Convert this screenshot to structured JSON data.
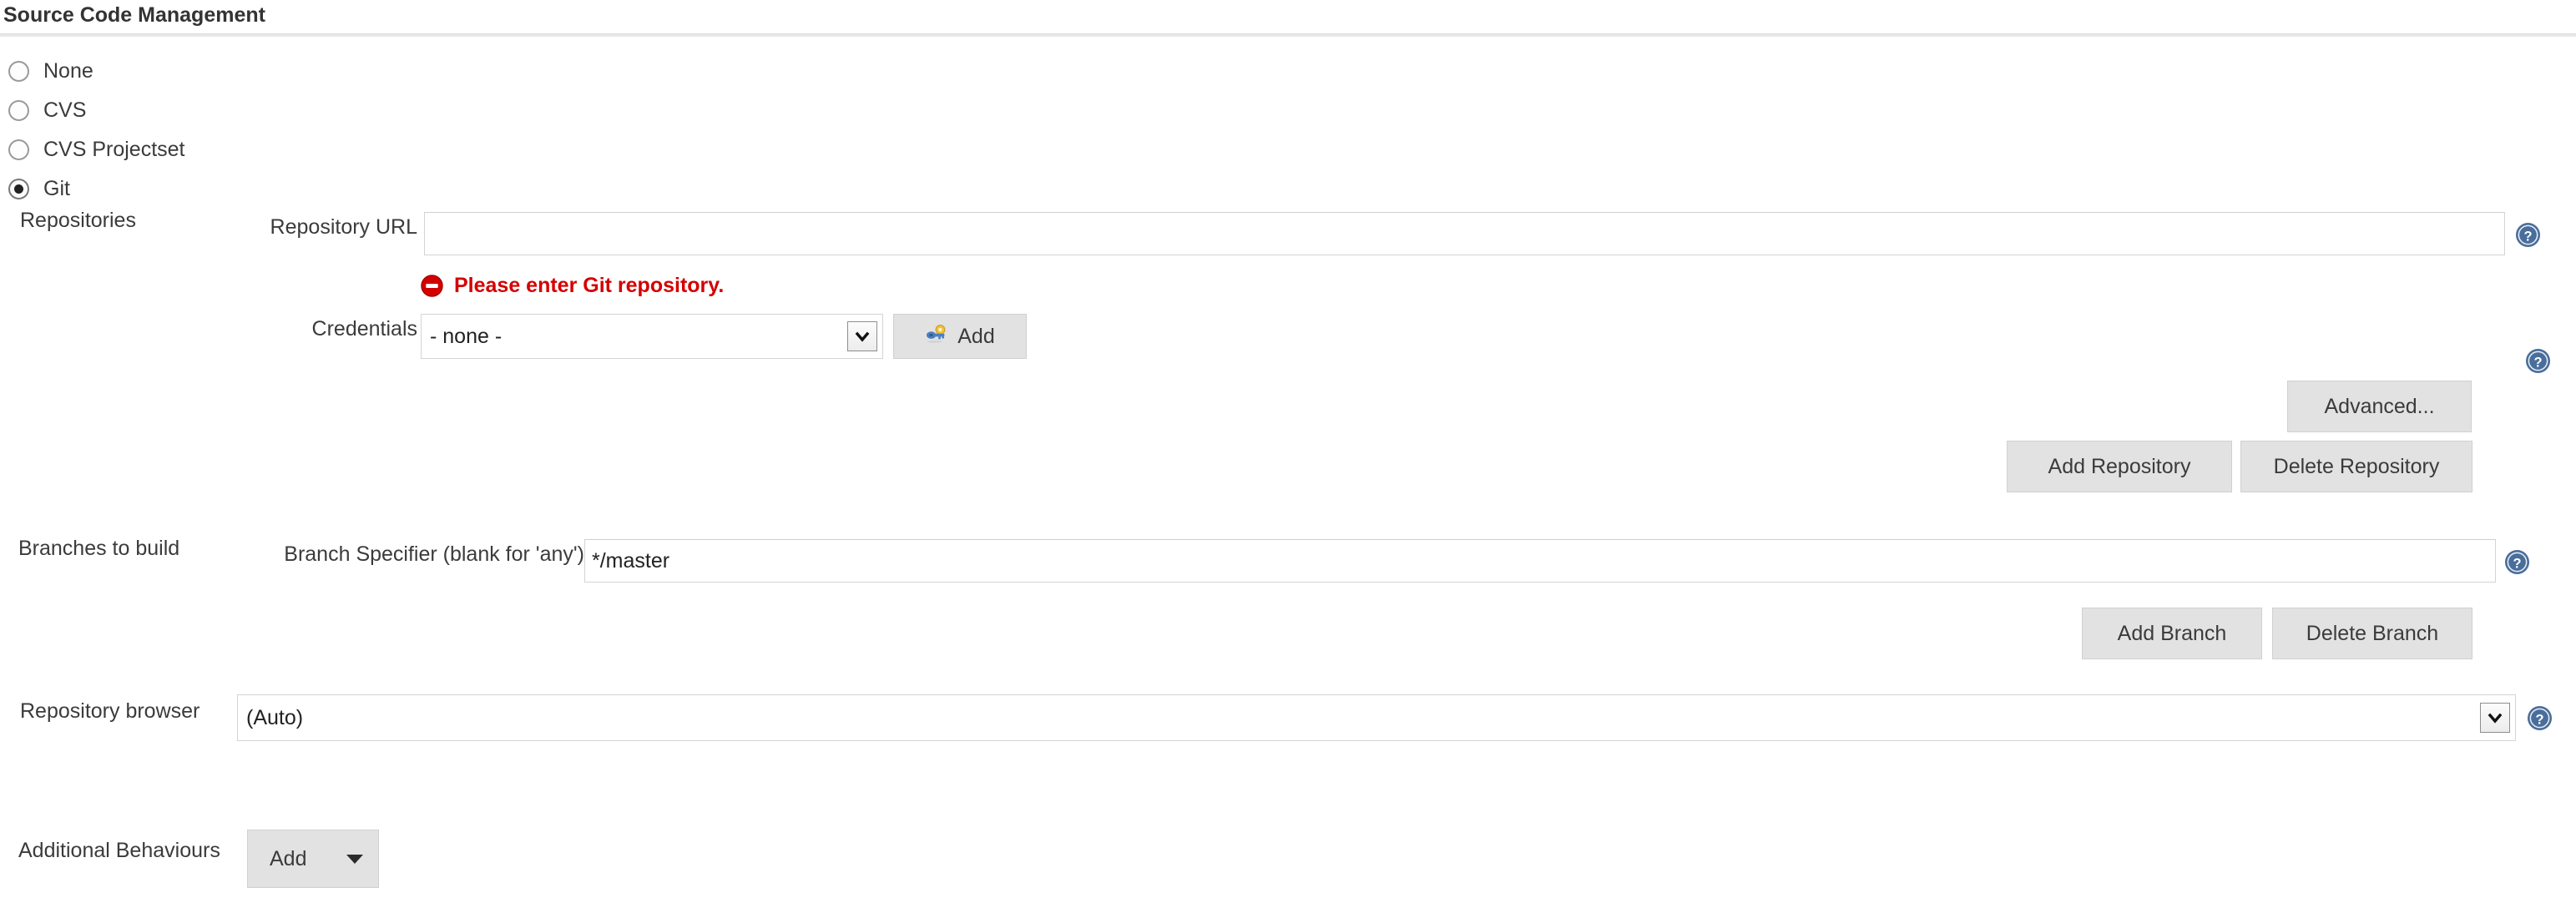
{
  "section": {
    "title": "Source Code Management"
  },
  "scm_options": [
    {
      "label": "None",
      "selected": false
    },
    {
      "label": "CVS",
      "selected": false
    },
    {
      "label": "CVS Projectset",
      "selected": false
    },
    {
      "label": "Git",
      "selected": true
    }
  ],
  "repositories": {
    "group_label": "Repositories",
    "url": {
      "label": "Repository URL",
      "value": "",
      "placeholder": ""
    },
    "url_error": {
      "text": "Please enter Git repository.",
      "icon": "error-circle-icon",
      "color": "#d40000"
    },
    "credentials": {
      "label": "Credentials",
      "selected": "- none -",
      "options": [
        "- none -"
      ],
      "add_button": {
        "label": "Add",
        "icon": "credentials-key-icon"
      }
    },
    "advanced_button": "Advanced...",
    "add_repository_button": "Add Repository",
    "delete_repository_button": "Delete Repository"
  },
  "branches": {
    "group_label": "Branches to build",
    "specifier": {
      "label": "Branch Specifier (blank for 'any')",
      "value": "*/master"
    },
    "add_branch_button": "Add Branch",
    "delete_branch_button": "Delete Branch"
  },
  "repository_browser": {
    "label": "Repository browser",
    "selected": "(Auto)",
    "options": [
      "(Auto)"
    ]
  },
  "additional_behaviours": {
    "label": "Additional Behaviours",
    "add_button": "Add"
  },
  "help_icons": {
    "name": "help-icon",
    "color": "#4a6e9b"
  }
}
